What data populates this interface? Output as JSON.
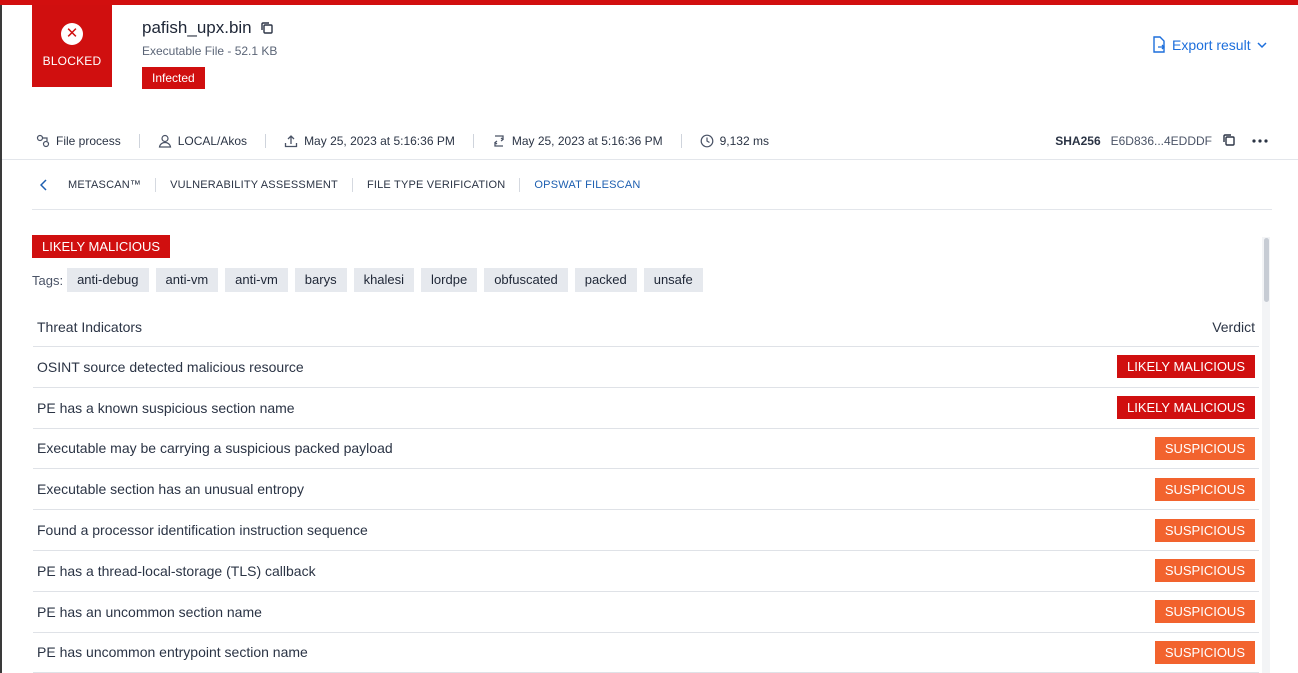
{
  "status": {
    "label": "BLOCKED",
    "icon": "close-icon"
  },
  "file": {
    "name": "pafish_upx.bin",
    "meta": "Executable File - 52.1 KB",
    "result_badge": "Infected"
  },
  "export": {
    "label": "Export result"
  },
  "meta_bar": {
    "process": "File process",
    "user": "LOCAL/Akos",
    "uploaded": "May 25, 2023 at 5:16:36 PM",
    "processed": "May 25, 2023 at 5:16:36 PM",
    "duration": "9,132 ms",
    "hash_label": "SHA256",
    "hash_value": "E6D836...4EDDDF"
  },
  "tabs": [
    {
      "label": "METASCAN™"
    },
    {
      "label": "VULNERABILITY ASSESSMENT"
    },
    {
      "label": "FILE TYPE VERIFICATION"
    },
    {
      "label": "OPSWAT FILESCAN",
      "active": true
    }
  ],
  "verdict": "LIKELY MALICIOUS",
  "tags_label": "Tags:",
  "tags": [
    "anti-debug",
    "anti-vm",
    "anti-vm",
    "barys",
    "khalesi",
    "lordpe",
    "obfuscated",
    "packed",
    "unsafe"
  ],
  "table": {
    "col_indicator": "Threat Indicators",
    "col_verdict": "Verdict",
    "rows": [
      {
        "indicator": "OSINT source detected malicious resource",
        "verdict": "LIKELY MALICIOUS"
      },
      {
        "indicator": "PE has a known suspicious section name",
        "verdict": "LIKELY MALICIOUS"
      },
      {
        "indicator": "Executable may be carrying a suspicious packed payload",
        "verdict": "SUSPICIOUS"
      },
      {
        "indicator": "Executable section has an unusual entropy",
        "verdict": "SUSPICIOUS"
      },
      {
        "indicator": "Found a processor identification instruction sequence",
        "verdict": "SUSPICIOUS"
      },
      {
        "indicator": "PE has a thread-local-storage (TLS) callback",
        "verdict": "SUSPICIOUS"
      },
      {
        "indicator": "PE has an uncommon section name",
        "verdict": "SUSPICIOUS"
      },
      {
        "indicator": "PE has uncommon entrypoint section name",
        "verdict": "SUSPICIOUS"
      }
    ]
  },
  "colors": {
    "brand_red": "#d00f0f",
    "suspicious_orange": "#f2632e",
    "link_blue": "#1d6fdc"
  }
}
